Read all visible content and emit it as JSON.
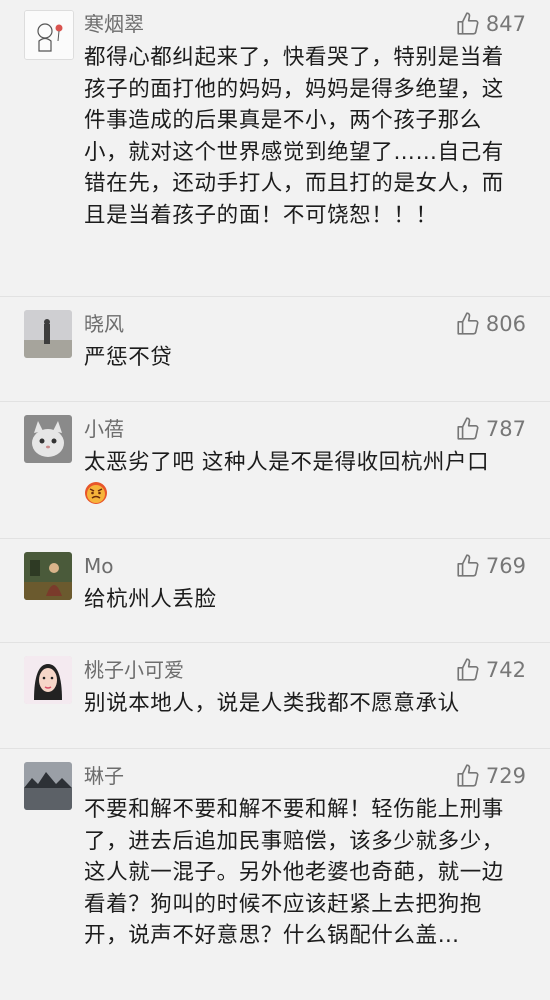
{
  "comments": [
    {
      "username": "寒烟翠",
      "likes": "847",
      "text": "都得心都纠起来了，快看哭了，特别是当着孩子的面打他的妈妈，妈妈是得多绝望，这件事造成的后果真是不小，两个孩子那么小，就对这个世界感觉到绝望了……自己有错在先，还动手打人，而且打的是女人，而且是当着孩子的面！不可饶恕！！！"
    },
    {
      "username": "晓风",
      "likes": "806",
      "text": "严惩不贷"
    },
    {
      "username": "小蓓",
      "likes": "787",
      "text": "太恶劣了吧 这种人是不是得收回杭州户口",
      "emoji": "angry-face-emoji"
    },
    {
      "username": "Mo",
      "likes": "769",
      "text": "给杭州人丢脸"
    },
    {
      "username": "桃子小可爱",
      "likes": "742",
      "text": "别说本地人，说是人类我都不愿意承认"
    },
    {
      "username": "琳子",
      "likes": "729",
      "text": "不要和解不要和解不要和解！轻伤能上刑事了，进去后追加民事赔偿，该多少就多少，这人就一混子。另外他老婆也奇葩，就一边看着？狗叫的时候不应该赶紧上去把狗抱开，说声不好意思？什么锅配什么盖…"
    }
  ],
  "colors": {
    "background": "#f2f2f2",
    "username": "#6d6d6d",
    "text": "#1c1c1c",
    "like": "#777777"
  },
  "icons": {
    "like": "thumbs-up-icon"
  }
}
